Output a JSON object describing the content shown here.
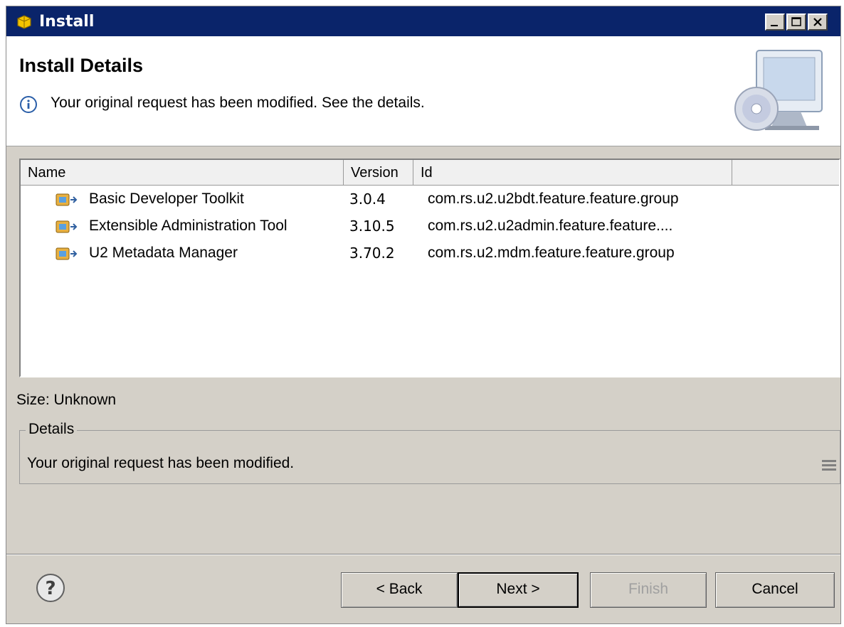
{
  "window": {
    "title": "Install"
  },
  "header": {
    "title": "Install Details",
    "message": "Your original request has been modified.  See the details."
  },
  "table": {
    "columns": {
      "name": "Name",
      "version": "Version",
      "id": "Id"
    },
    "rows": [
      {
        "name": "Basic Developer Toolkit",
        "version": "3.0.4",
        "id": "com.rs.u2.u2bdt.feature.feature.group"
      },
      {
        "name": "Extensible Administration Tool",
        "version": "3.10.5",
        "id": "com.rs.u2.u2admin.feature.feature...."
      },
      {
        "name": "U2 Metadata Manager",
        "version": "3.70.2",
        "id": "com.rs.u2.mdm.feature.feature.group"
      }
    ]
  },
  "size": {
    "label": "Size: Unknown"
  },
  "details": {
    "legend": "Details",
    "text": "Your original request has been modified."
  },
  "buttons": {
    "back": "< Back",
    "next": "Next >",
    "finish": "Finish",
    "cancel": "Cancel"
  },
  "icons": {
    "window": "install-package-icon",
    "info": "info-icon",
    "banner": "computer-cd-icon",
    "feature": "feature-plugin-icon",
    "help": "help-icon"
  }
}
